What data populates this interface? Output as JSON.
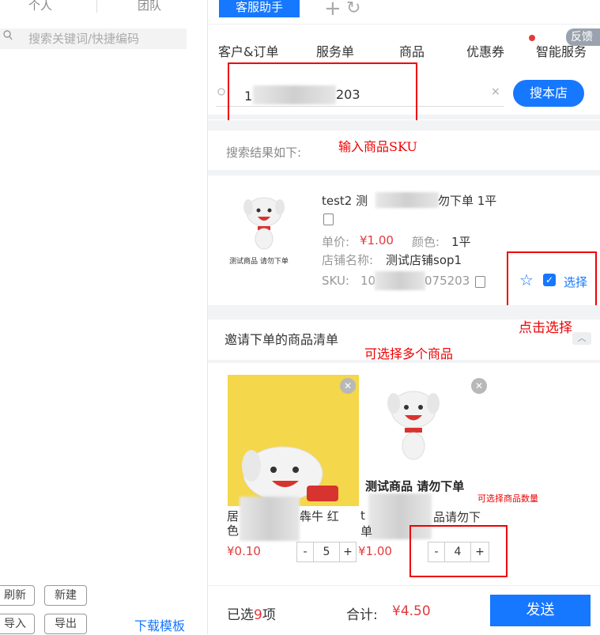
{
  "left_panel": {
    "tabs": [
      "个人",
      "团队"
    ],
    "search_placeholder": "搜索关键词/快捷编码",
    "buttons": [
      "刷新",
      "新建",
      "导入",
      "导出"
    ],
    "download_template": "下载模板"
  },
  "header": {
    "active_tab": "客服助手",
    "plus_label": "+",
    "refresh_label": "↻",
    "feedback_label": "反馈"
  },
  "subtabs": [
    "客户&订单",
    "服务单",
    "商品",
    "优惠券",
    "智能服务"
  ],
  "search": {
    "value_visible": "203",
    "value_prefix": "1",
    "clear_label": "×",
    "button_label": "搜本店"
  },
  "annotations": {
    "input_sku": "输入商品SKU",
    "click_select": "点击选择",
    "multi_select": "可选择多个商品",
    "qty_select": "可选择商品数量"
  },
  "result": {
    "title": "搜索结果如下:",
    "product": {
      "name_prefix": "test2 测",
      "name_suffix": "勿下单 1平",
      "price_label": "单价:",
      "price_value": "¥1.00",
      "color_label": "颜色:",
      "color_value": "1平",
      "shop_label": "店铺名称:",
      "shop_value": "测试店铺sop1",
      "sku_label": "SKU:",
      "sku_prefix": "10",
      "sku_suffix": "075203",
      "image_caption": "测试商品 请勿下单",
      "select_label": "选择"
    }
  },
  "invite": {
    "title": "邀请下单的商品清单",
    "items": [
      {
        "name_prefix": "居",
        "name_suffix": "犇牛 红",
        "name_line2": "色",
        "price": "¥0.10",
        "qty_minus": "-",
        "qty": "5",
        "qty_plus": "+"
      },
      {
        "image_caption": "测试商品  请勿下单",
        "name_prefix": "t",
        "name_suffix": "品请勿下",
        "name_line2": "单",
        "price": "¥1.00",
        "qty_minus": "-",
        "qty": "4",
        "qty_plus": "+"
      }
    ]
  },
  "footer": {
    "selected_prefix": "已选",
    "selected_count": "9",
    "selected_suffix": "项",
    "total_label": "合计:",
    "total_value": "¥4.50",
    "send_label": "发送"
  },
  "colors": {
    "primary": "#1677ff",
    "price_red": "#e4393c",
    "annotation_red": "#e00000"
  }
}
